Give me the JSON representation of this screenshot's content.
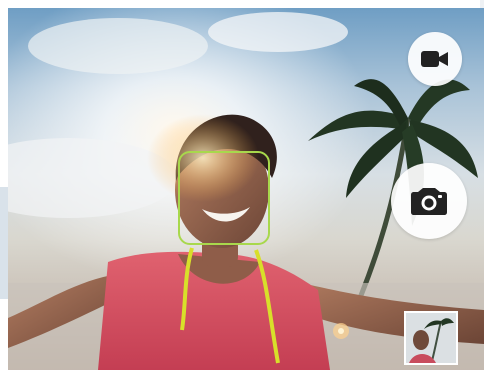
{
  "screen": {
    "title": ""
  },
  "controls": {
    "video_button_icon": "video-camera-icon",
    "photo_button_icon": "camera-icon",
    "gallery_thumbnail_icon": "gallery-thumbnail"
  },
  "colors": {
    "focus_box": "#a8d84c",
    "button_bg": "#ffffff",
    "icon_color": "#222222"
  }
}
